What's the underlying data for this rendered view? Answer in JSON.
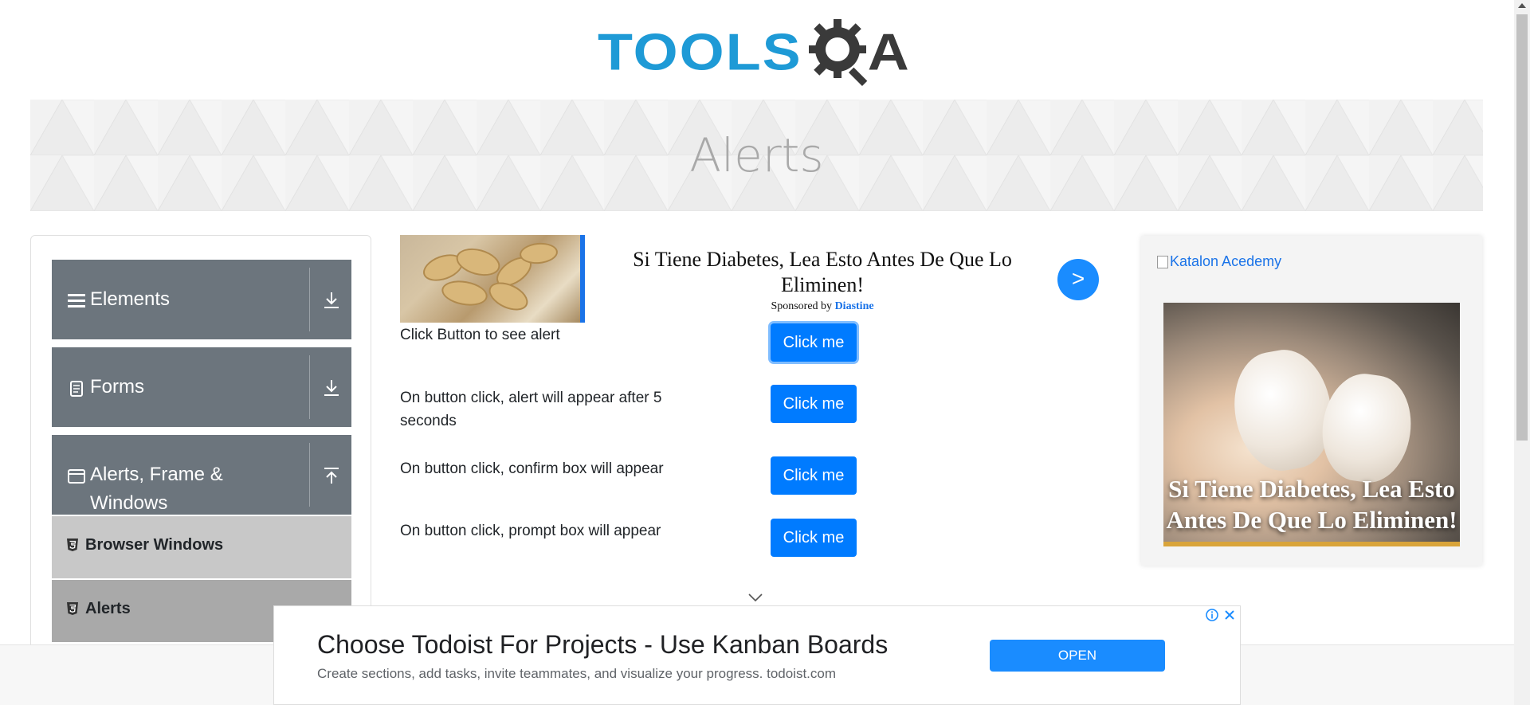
{
  "logo": {
    "text_left": "TOOLS",
    "text_right": "A"
  },
  "banner": {
    "title": "Alerts"
  },
  "sidebar": {
    "groups": [
      {
        "label": "Elements",
        "expanded": false
      },
      {
        "label": "Forms",
        "expanded": false
      },
      {
        "label": "Alerts, Frame & Windows",
        "label_line1": "Alerts, Frame &",
        "label_line2": "Windows",
        "expanded": true
      }
    ],
    "items": [
      {
        "label": "Browser Windows",
        "active": false
      },
      {
        "label": "Alerts",
        "active": true
      }
    ]
  },
  "ad_top": {
    "headline": "Si Tiene Diabetes, Lea Esto Antes De Que Lo Eliminen!",
    "sponsored_prefix": "Sponsored by",
    "brand": "Diastine",
    "go_label": ">"
  },
  "alerts": {
    "rows": [
      {
        "text": "Click Button to see alert",
        "button": "Click me"
      },
      {
        "text": "On button click, alert will appear after 5 seconds",
        "text_line1": "On button click, alert will appear after 5",
        "text_line2": "seconds",
        "button": "Click me"
      },
      {
        "text": "On button click, confirm box will appear",
        "button": "Click me"
      },
      {
        "text": "On button click, prompt box will appear",
        "button": "Click me"
      }
    ]
  },
  "ad_right": {
    "broken_image_alt": "Katalon Acedemy",
    "caption": "Si Tiene Diabetes, Lea Esto Antes De Que Lo Eliminen!"
  },
  "ad_bottom": {
    "headline": "Choose Todoist For Projects - Use Kanban Boards",
    "subtext": "Create sections, add tasks, invite teammates, and visualize your progress. todoist.com",
    "button": "OPEN"
  },
  "colors": {
    "primary": "#007bff",
    "sidebar_group": "#6c757d",
    "logo_blue": "#1e9ad6",
    "logo_dark": "#3a3a3a"
  }
}
